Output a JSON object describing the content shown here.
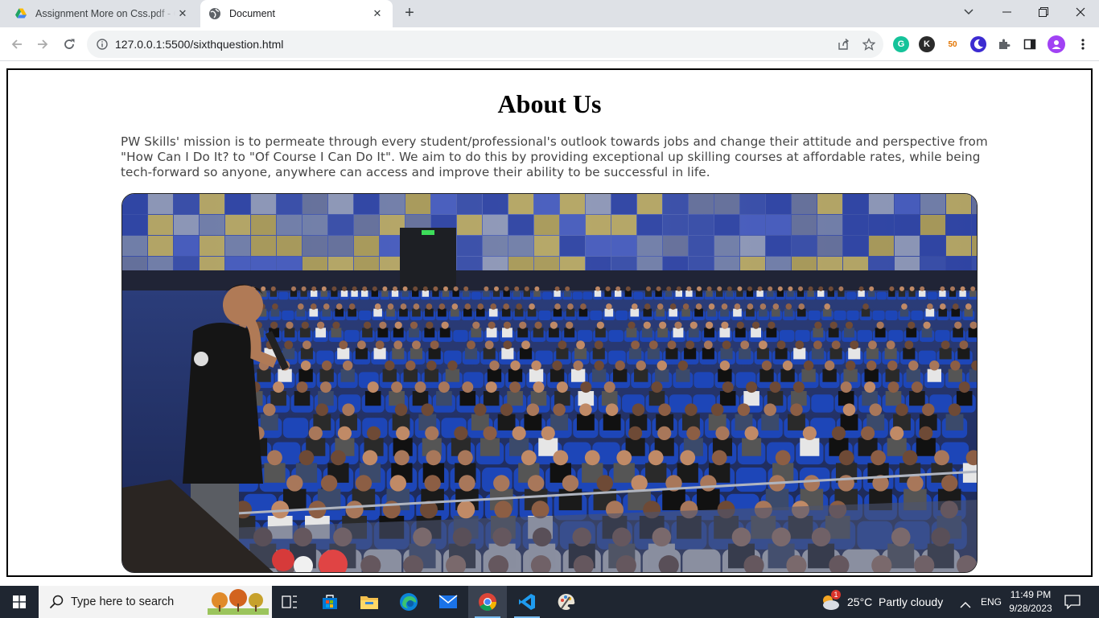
{
  "browser": {
    "tabs": [
      {
        "title": "Assignment More on Css.pdf - G",
        "favicon": "google-drive-icon",
        "active": false
      },
      {
        "title": "Document",
        "favicon": "globe-icon",
        "active": true
      }
    ],
    "url": "127.0.0.1:5500/sixthquestion.html"
  },
  "page": {
    "heading": "About Us",
    "paragraph": "PW Skills' mission is to permeate through every student/professional's outlook towards jobs and change their attitude and perspective from \"How Can I Do It? to \"Of Course I Can Do It\". We aim to do this by providing exceptional up skilling courses at affordable rates, while being tech-forward so anyone, anywhere can access and improve their ability to be successful in life.",
    "image_subject": "speaker-addressing-auditorium-photo"
  },
  "taskbar": {
    "search_placeholder": "Type here to search",
    "weather": "25°C  Partly cloudy",
    "weather_badge": "1",
    "language": "ENG",
    "time": "11:49 PM",
    "date": "9/28/2023"
  },
  "extensions": {
    "k_label": "K",
    "counter_label": "50"
  },
  "colors": {
    "tabstrip": "#dee1e6",
    "taskbar": "#1f2631",
    "accent_blue": "#1a73e8",
    "seat_blue": "#1d46b8"
  }
}
